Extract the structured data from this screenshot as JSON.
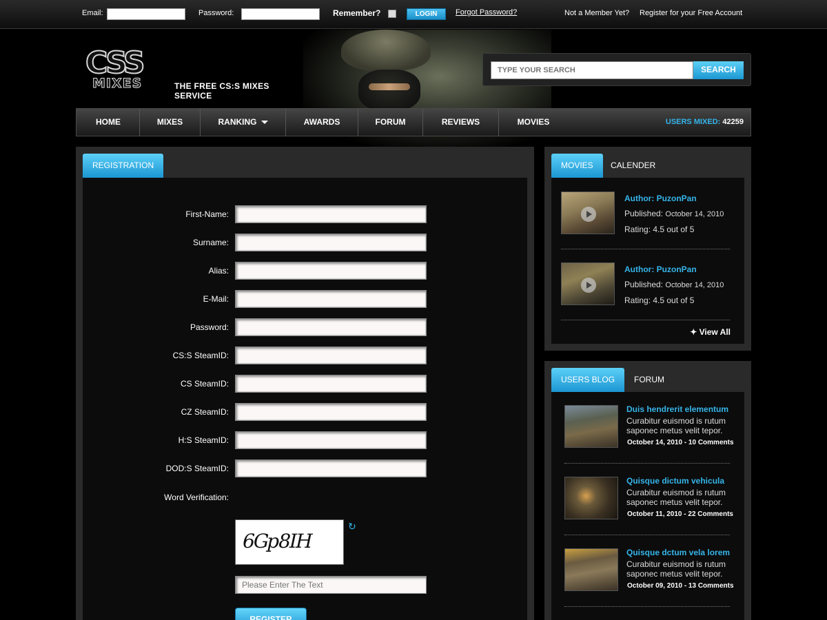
{
  "topbar": {
    "email_label": "Email:",
    "password_label": "Password:",
    "remember_label": "Remember?",
    "login_label": "LOGIN",
    "forgot_label": "Forgot Password?",
    "not_member": "Not a Member Yet?",
    "register_link": "Register for your Free Account"
  },
  "brand": {
    "logo_top": "CSS",
    "logo_bottom": "MIXES",
    "tagline": "THE FREE CS:S MIXES SERVICE"
  },
  "search": {
    "placeholder": "TYPE YOUR SEARCH",
    "button": "SEARCH"
  },
  "nav": {
    "items": [
      "HOME",
      "MIXES",
      "RANKING",
      "AWARDS",
      "FORUM",
      "REVIEWS",
      "MOVIES"
    ],
    "users_label": "USERS MIXED:",
    "users_count": "42259"
  },
  "registration": {
    "tab": "REGISTRATION",
    "fields": [
      "First-Name:",
      "Surname:",
      "Alias:",
      "E-Mail:",
      "Password:",
      "CS:S SteamID:",
      "CS SteamID:",
      "CZ SteamID:",
      "H:S SteamID:",
      "DOD:S SteamID:"
    ],
    "verification_label": "Word Verification:",
    "captcha_text": "6Gp8IH",
    "captcha_placeholder": "Please Enter The Text",
    "register_button": "REGISTER"
  },
  "movies_panel": {
    "tab_active": "MOVIES",
    "tab_other": "CALENDER",
    "items": [
      {
        "author": "Author: PuzonPan",
        "published_label": "Published:",
        "published_date": "October 14, 2010",
        "rating": "Rating: 4.5 out of 5"
      },
      {
        "author": "Author: PuzonPan",
        "published_label": "Published:",
        "published_date": "October 14, 2010",
        "rating": "Rating: 4.5 out of 5"
      }
    ],
    "view_all": "View All"
  },
  "blog_panel": {
    "tab_active": "USERS BLOG",
    "tab_other": "FORUM",
    "items": [
      {
        "title": "Duis hendrerit elementum",
        "excerpt": "Curabitur euismod is rutum saponec metus velit tepor.",
        "meta": "October 14, 2010 - 10 Comments"
      },
      {
        "title": "Quisque dictum vehicula",
        "excerpt": "Curabitur euismod is rutum saponec metus velit tepor.",
        "meta": "October 11, 2010 - 22 Comments"
      },
      {
        "title": "Quisque dctum vela lorem",
        "excerpt": "Curabitur euismod is rutum saponec metus velit tepor.",
        "meta": "October 09, 2010 - 13 Comments"
      }
    ]
  },
  "colors": {
    "accent": "#35b5ea",
    "background": "#000000",
    "panel": "#2a2a2a"
  }
}
